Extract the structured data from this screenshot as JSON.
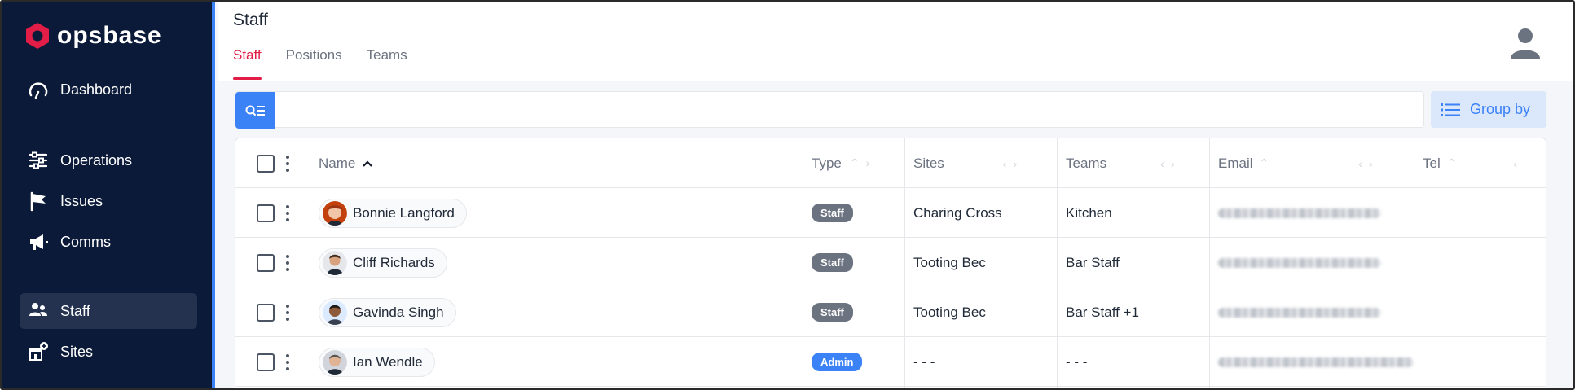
{
  "brand": {
    "name": "opsbase",
    "accent": "#e11d48",
    "sidebar_bg": "#0b1a38",
    "primary": "#3b82f6"
  },
  "sidebar": {
    "items": [
      {
        "label": "Dashboard",
        "icon": "gauge-icon",
        "active": false
      },
      {
        "label": "Operations",
        "icon": "sliders-icon",
        "active": false
      },
      {
        "label": "Issues",
        "icon": "flag-icon",
        "active": false
      },
      {
        "label": "Comms",
        "icon": "megaphone-icon",
        "active": false
      },
      {
        "label": "Staff",
        "icon": "users-icon",
        "active": true
      },
      {
        "label": "Sites",
        "icon": "store-add-icon",
        "active": false
      }
    ]
  },
  "header": {
    "title": "Staff",
    "tabs": [
      {
        "label": "Staff",
        "active": true
      },
      {
        "label": "Positions",
        "active": false
      },
      {
        "label": "Teams",
        "active": false
      }
    ],
    "user_icon": "user-avatar-icon"
  },
  "search": {
    "placeholder": "",
    "value": "",
    "icon": "search-filter-icon"
  },
  "group_by": {
    "label": "Group by",
    "icon": "list-icon"
  },
  "table": {
    "columns": [
      {
        "key": "name",
        "label": "Name",
        "sort": "asc"
      },
      {
        "key": "type",
        "label": "Type"
      },
      {
        "key": "sites",
        "label": "Sites"
      },
      {
        "key": "teams",
        "label": "Teams"
      },
      {
        "key": "email",
        "label": "Email"
      },
      {
        "key": "tel",
        "label": "Tel"
      }
    ],
    "rows": [
      {
        "name": "Bonnie Langford",
        "type": "Staff",
        "sites": "Charing Cross",
        "teams": "Kitchen",
        "email_blurred": true,
        "tel": ""
      },
      {
        "name": "Cliff Richards",
        "type": "Staff",
        "sites": "Tooting Bec",
        "teams": "Bar Staff",
        "email_blurred": true,
        "tel": ""
      },
      {
        "name": "Gavinda Singh",
        "type": "Staff",
        "sites": "Tooting Bec",
        "teams": "Bar Staff +1",
        "email_blurred": true,
        "tel": ""
      },
      {
        "name": "Ian Wendle",
        "type": "Admin",
        "sites": "- - -",
        "teams": "- - -",
        "email_blurred": true,
        "tel": ""
      }
    ]
  }
}
